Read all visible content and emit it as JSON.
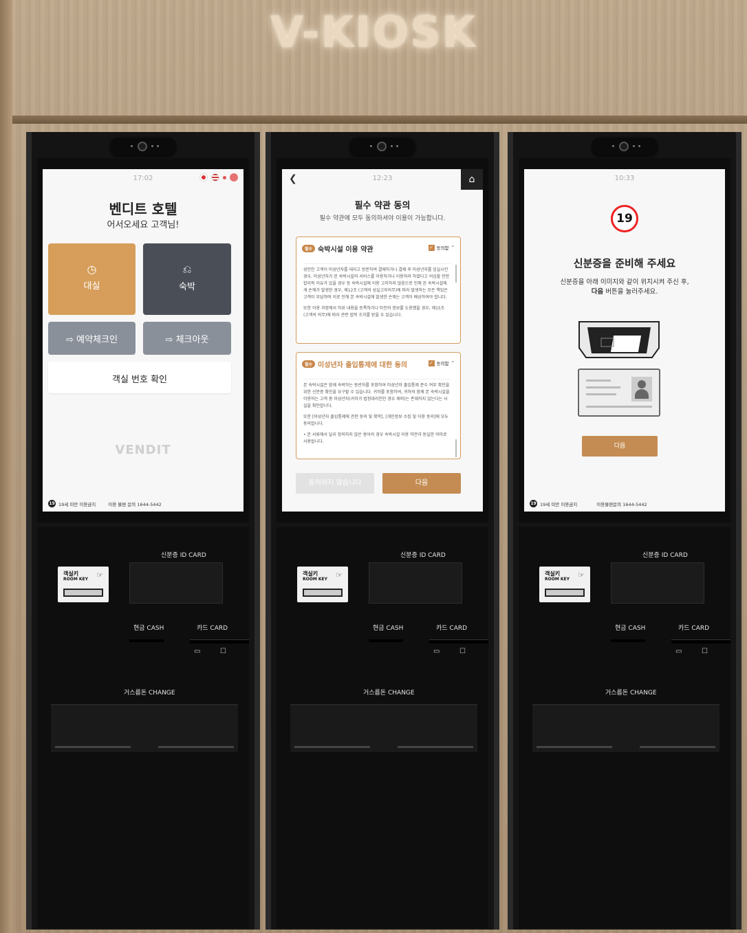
{
  "brand": "V-KIOSK",
  "hardware": {
    "id_card_label": "신분증 ID CARD",
    "room_key_label_ko": "객실키",
    "room_key_label_en": "ROOM KEY",
    "cash_label": "현금 CASH",
    "card_label": "카드 CARD",
    "change_label": "거스름돈 CHANGE"
  },
  "screen1": {
    "time": "17:02",
    "title": "벤디트 호텔",
    "subtitle": "어서오세요 고객님!",
    "tiles": {
      "daesil": "대실",
      "sukbak": "숙박",
      "checkin": "예약체크인",
      "checkout": "체크아웃",
      "room_check": "객실 번호 확인"
    },
    "logo": "VENDIT",
    "footer_age": "19세 미만 이용금지",
    "footer_contact": "이용 불편 문의 1644-5442"
  },
  "screen2": {
    "time": "12:23",
    "title": "필수 약관 동의",
    "subtitle": "필수 약관에 모두 동의하셔야 이용이 가능합니다.",
    "required_tag": "필수",
    "agree_label": "동의함",
    "term1_title": "숙박시설 이용 약관",
    "term1_p1": "성인인 고객이 미성년자를 데리고 방문하여 결제하거나 결제 후 미성년자를 입실시킨 경우, 미성년자가 본 숙박시설의 서비스를 이용하거나 이용하려 하였다고 의심할 만한 합리적 이유가 있을 경우 등 숙박시설에 이용 고지하지 않음으로 인해 본 숙박시설에게 손해가 발생한 경우, 제12조 (고객의 성실고지의무)에 따라 발생하는 모든 책임은 고객이 부담하며 이로 인해 본 숙박시설에 발생한 손해는 고객이 배상하여야 합니다.",
    "term1_p2": "또한 이용 과정에서 허위 내용을 등록하거나 타인의 정보를 도용했을 경우, 제15조 (고객의 의무)에 따라 관련 법적 조치를 받을 수 있습니다.",
    "term2_title": "미성년자 출입통제에 대한 동의",
    "term2_p1": "본 숙박시설은 함께 숙박하는 동반자를 포함하여 미성년자 출입통제 준수 여부 확인을 위한 신분증 확인을 요구할 수 있습니다. 귀하를 포함하여, 귀하와 함께 본 숙박시설을 이용하는 고객 중 미성년자(귀하가 법정대리인인 경우 제외)는 존재하지 않는다는 사실을 확인합니다.",
    "term2_p2": "또한 [미성년자 출입통제에 관한 동의 및 확약], [개인정보 수집 및 이용 동의]에 모두 동의합니다.",
    "term2_p3": "• 본 서류에서 달리 정의하지 않은 용어의 경우 숙박시설 이용 약관과 동일한 의미로 사용됩니다.",
    "btn_disagree": "동의하지 않습니다",
    "btn_next": "다음"
  },
  "screen3": {
    "time": "10:33",
    "age_badge": "19",
    "title": "신분증을 준비해 주세요",
    "sub1": "신분증을 아래 이미지와 같이 위치시켜 주신 후,",
    "sub2_bold": "다음",
    "sub2_rest": " 버튼을 눌러주세요.",
    "btn_next": "다음",
    "footer_age": "19세 미만 이용금지",
    "footer_contact": "이용불편문의 1644-5442"
  },
  "colors": {
    "accent": "#c48c52",
    "tile_orange": "#d69e5a",
    "tile_dark": "#4a4e57",
    "tile_gray": "#8a909a"
  }
}
